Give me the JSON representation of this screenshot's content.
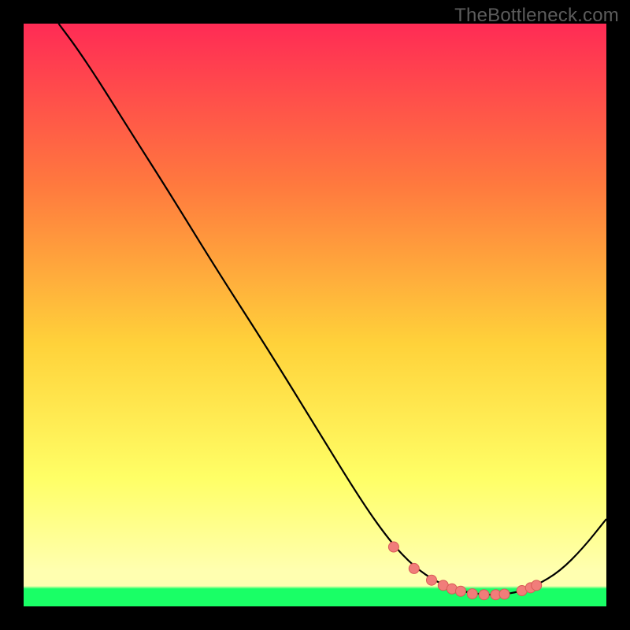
{
  "watermark": "TheBottleneck.com",
  "colors": {
    "bg": "#000000",
    "grad_top": "#ff2b55",
    "grad_mid_upper": "#ff7a3e",
    "grad_mid": "#ffd23a",
    "grad_mid_lower": "#ffff66",
    "grad_lower": "#ffffb0",
    "grad_band": "#19ff66",
    "curve": "#000000",
    "dot_fill": "#f17d7a",
    "dot_stroke": "#d85b57"
  },
  "chart_data": {
    "type": "line",
    "title": "",
    "xlabel": "",
    "ylabel": "",
    "xlim": [
      0,
      100
    ],
    "ylim": [
      0,
      100
    ],
    "curve": {
      "name": "bottleneck-curve",
      "x": [
        6,
        9,
        13,
        18,
        25,
        33,
        42,
        50,
        58,
        63,
        67,
        71,
        75,
        79,
        82,
        85,
        88,
        92,
        96,
        100
      ],
      "y": [
        100,
        96,
        90,
        82,
        71,
        58,
        44,
        31,
        18,
        11,
        6.8,
        4.1,
        2.6,
        2.0,
        2.0,
        2.5,
        3.6,
        6.0,
        10.0,
        15.0
      ]
    },
    "optimal_band_y": [
      0,
      3
    ],
    "markers": {
      "name": "sample-points",
      "x": [
        63.5,
        67.0,
        70.0,
        72.0,
        73.5,
        75.0,
        77.0,
        79.0,
        81.0,
        82.5,
        85.5,
        87.0,
        88.0
      ],
      "y": [
        10.2,
        6.5,
        4.5,
        3.6,
        3.0,
        2.6,
        2.15,
        2.0,
        2.0,
        2.1,
        2.7,
        3.2,
        3.6
      ]
    }
  }
}
